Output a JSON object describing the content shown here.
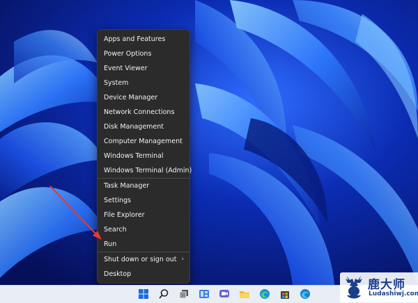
{
  "desktop": {
    "wallpaper": "windows-11-bloom"
  },
  "context_menu": {
    "groups": [
      [
        "Apps and Features",
        "Power Options",
        "Event Viewer",
        "System",
        "Device Manager",
        "Network Connections",
        "Disk Management",
        "Computer Management",
        "Windows Terminal",
        "Windows Terminal (Admin)"
      ],
      [
        "Task Manager",
        "Settings",
        "File Explorer",
        "Search",
        "Run"
      ],
      [
        "Shut down or sign out",
        "Desktop"
      ]
    ],
    "shutdown_has_submenu": true,
    "highlighted_item": "Run"
  },
  "annotation": {
    "arrow_color": "#e53935",
    "points_to": "Run"
  },
  "taskbar": {
    "icons": [
      "windows-start-icon",
      "search-icon",
      "task-view-icon",
      "widgets-icon",
      "teams-chat-icon",
      "file-explorer-icon",
      "edge-icon",
      "microsoft-store-icon",
      "edge-icon-2"
    ]
  },
  "watermark": {
    "chinese": "鹿大师",
    "url": "Ludashiwj.com"
  }
}
